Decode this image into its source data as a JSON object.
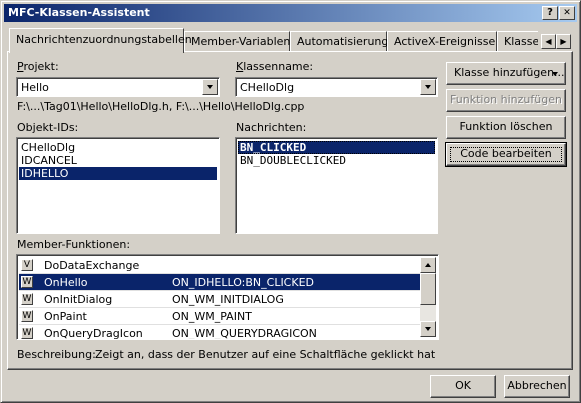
{
  "window": {
    "title": "MFC-Klassen-Assistent",
    "help_glyph": "?",
    "close_glyph": "✕"
  },
  "tabs": [
    {
      "label": "Nachrichtenzuordnungstabellen",
      "active": true
    },
    {
      "label": "Member-Variablen",
      "active": false
    },
    {
      "label": "Automatisierung",
      "active": false
    },
    {
      "label": "ActiveX-Ereignisse",
      "active": false
    },
    {
      "label": "Klassen-Info",
      "active": false
    }
  ],
  "project": {
    "label": "Projekt:",
    "value": "Hello"
  },
  "classname": {
    "label": "Klassenname:",
    "value": "CHelloDlg"
  },
  "file_path": "F:\\...\\Tag01\\Hello\\HelloDlg.h, F:\\...\\Hello\\HelloDlg.cpp",
  "object_ids": {
    "label": "Objekt-IDs:",
    "items": [
      "CHelloDlg",
      "IDCANCEL",
      "IDHELLO"
    ],
    "selected_index": 2
  },
  "messages": {
    "label": "Nachrichten:",
    "items": [
      "BN_CLICKED",
      "BN_DOUBLECLICKED"
    ],
    "selected_index": 0
  },
  "member_functions": {
    "label": "Member-Funktionen:",
    "rows": [
      {
        "badge": "V",
        "name": "DoDataExchange",
        "mapping": ""
      },
      {
        "badge": "W",
        "name": "OnHello",
        "mapping": "ON_IDHELLO:BN_CLICKED"
      },
      {
        "badge": "W",
        "name": "OnInitDialog",
        "mapping": "ON_WM_INITDIALOG"
      },
      {
        "badge": "W",
        "name": "OnPaint",
        "mapping": "ON_WM_PAINT"
      },
      {
        "badge": "W",
        "name": "OnQueryDragIcon",
        "mapping": "ON_WM_QUERYDRAGICON"
      }
    ],
    "selected_index": 1
  },
  "description": {
    "label": "Beschreibung:",
    "text": "Zeigt an, dass der Benutzer auf eine Schaltfläche geklickt hat"
  },
  "side_buttons": {
    "add_class": "Klasse hinzufügen...",
    "add_function": "Funktion hinzufügen",
    "delete_function": "Funktion löschen",
    "edit_code": "Code bearbeiten"
  },
  "footer": {
    "ok": "OK",
    "cancel": "Abbrechen"
  },
  "colors": {
    "face": "#d4d0c8",
    "title_start": "#0a246a",
    "title_end": "#a6caf0",
    "selection": "#0a246a"
  }
}
